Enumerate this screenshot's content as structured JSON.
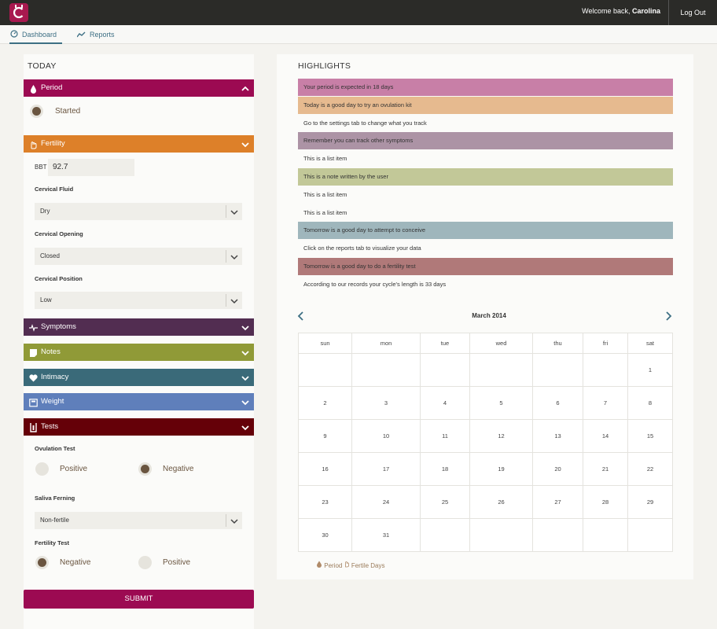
{
  "topbar": {
    "welcome_prefix": "Welcome back, ",
    "user_name": "Carolina",
    "logout_label": "Log Out"
  },
  "nav": {
    "tabs": [
      {
        "label": "Dashboard",
        "active": true
      },
      {
        "label": "Reports",
        "active": false
      }
    ]
  },
  "today": {
    "title": "TODAY",
    "period": {
      "label": "Period",
      "color": "#9c0a52",
      "option": "Started",
      "checked": true
    },
    "fertility": {
      "label": "Fertility",
      "color": "#dd8029",
      "bbt_label": "BBT",
      "bbt_value": "92.7",
      "cervical_fluid": {
        "label": "Cervical Fluid",
        "value": "Dry"
      },
      "cervical_opening": {
        "label": "Cervical Opening",
        "value": "Closed"
      },
      "cervical_position": {
        "label": "Cervical Position",
        "value": "Low"
      }
    },
    "sections": [
      {
        "label": "Symptoms",
        "color": "#522d51",
        "icon": "pulse-icon"
      },
      {
        "label": "Notes",
        "color": "#909a37",
        "icon": "note-icon"
      },
      {
        "label": "Intimacy",
        "color": "#3a6a79",
        "icon": "heart-icon"
      },
      {
        "label": "Weight",
        "color": "#5f7fbb",
        "icon": "scale-icon"
      }
    ],
    "tests": {
      "label": "Tests",
      "color": "#650008",
      "ovulation_test": {
        "label": "Ovulation Test",
        "options": [
          "Positive",
          "Negative"
        ],
        "selected": "Negative"
      },
      "saliva_ferning": {
        "label": "Saliva Ferning",
        "value": "Non-fertile"
      },
      "fertility_test": {
        "label": "Fertility Test",
        "options": [
          "Negative",
          "Positive"
        ],
        "selected": "Negative"
      }
    },
    "submit_label": "SUBMIT"
  },
  "highlights": {
    "title": "HIGHLIGHTS",
    "items": [
      {
        "text": "Your period is expected in 18 days",
        "color": "#c87fa7"
      },
      {
        "text": "Today is a good day to try an ovulation kit",
        "color": "#e6ba8f"
      },
      {
        "text": "Go to the settings tab to change what you track",
        "color": ""
      },
      {
        "text": "Remember you can track other symptoms",
        "color": "#ac93a5"
      },
      {
        "text": "This is a list item",
        "color": ""
      },
      {
        "text": "This is a note written by the user",
        "color": "#c2c898"
      },
      {
        "text": "This is a list item",
        "color": ""
      },
      {
        "text": "This is a list item",
        "color": ""
      },
      {
        "text": "Tomorrow is a good day to attempt to conceive",
        "color": "#9fb6bc"
      },
      {
        "text": "Click on the reports tab to visualize your data",
        "color": ""
      },
      {
        "text": "Tomorrow is a good day to do a fertility test",
        "color": "#b07979"
      },
      {
        "text": "According to our records your cycle's length is 33 days",
        "color": ""
      }
    ]
  },
  "calendar": {
    "month": "March 2014",
    "weekdays": [
      "sun",
      "mon",
      "tue",
      "wed",
      "thu",
      "fri",
      "sat"
    ],
    "weeks": [
      [
        "",
        "",
        "",
        "",
        "",
        "",
        "1"
      ],
      [
        "2",
        "3",
        "4",
        "5",
        "6",
        "7",
        "8"
      ],
      [
        "9",
        "10",
        "11",
        "12",
        "13",
        "14",
        "15"
      ],
      [
        "16",
        "17",
        "18",
        "19",
        "20",
        "21",
        "22"
      ],
      [
        "23",
        "24",
        "25",
        "26",
        "27",
        "28",
        "29"
      ],
      [
        "30",
        "31",
        "",
        "",
        "",
        "",
        ""
      ]
    ],
    "legend": {
      "period": "Period",
      "fertile": "Fertile Days"
    }
  }
}
